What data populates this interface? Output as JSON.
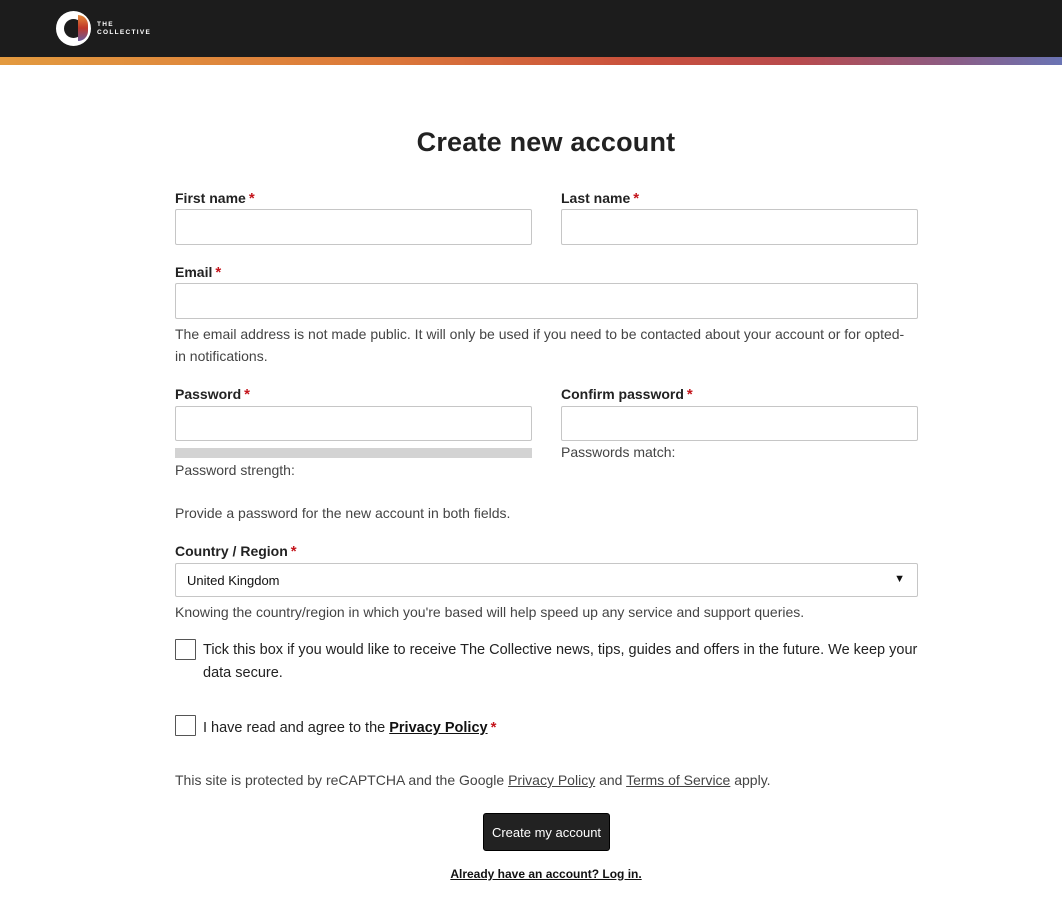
{
  "header": {
    "logo_line1": "THE",
    "logo_line2": "COLLECTIVE",
    "gradient_colors": [
      "#e39a3f",
      "#dc7a3a",
      "#c9503c",
      "#b84a4c",
      "#8a5d86",
      "#6a74b4"
    ]
  },
  "page": {
    "title": "Create new account"
  },
  "form": {
    "first_name": {
      "label": "First name",
      "value": ""
    },
    "last_name": {
      "label": "Last name",
      "value": ""
    },
    "email": {
      "label": "Email",
      "value": "",
      "help": "The email address is not made public. It will only be used if you need to be contacted about your account or for opted-in notifications."
    },
    "password": {
      "label": "Password",
      "strength_label": "Password strength:",
      "value": ""
    },
    "confirm_password": {
      "label": "Confirm password",
      "match_label": "Passwords match:",
      "value": ""
    },
    "password_help": "Provide a password for the new account in both fields.",
    "country": {
      "label": "Country / Region",
      "selected": "United Kingdom",
      "help": "Knowing the country/region in which you're based will help speed up any service and support queries."
    },
    "newsletter": {
      "text": "Tick this box if you would like to receive The Collective news, tips, guides and offers in the future. We keep your data secure.",
      "checked": false
    },
    "privacy": {
      "text_before": "I have read and agree to the",
      "link": "Privacy Policy",
      "checked": false
    },
    "required_marker": "*",
    "recaptcha": {
      "before": "This site is protected by reCAPTCHA and the Google",
      "privacy_link": "Privacy Policy",
      "and": "and",
      "terms_link": "Terms of Service",
      "after": "apply."
    },
    "submit_label": "Create my account",
    "login_link": "Already have an account? Log in."
  },
  "colors": {
    "accent_required": "#c4151c",
    "header_bg": "#1c1c1c",
    "button_bg": "#222222"
  }
}
